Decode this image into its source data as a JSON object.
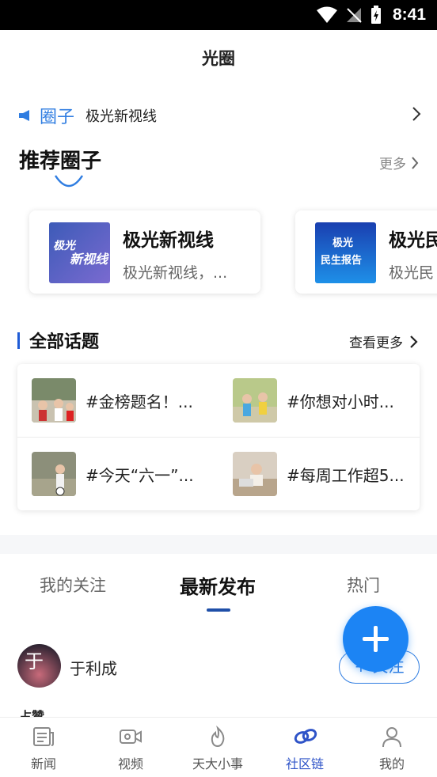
{
  "status_bar": {
    "time": "8:41"
  },
  "header": {
    "title": "光圈"
  },
  "circle_bar": {
    "tag": "圈子",
    "name": "极光新视线"
  },
  "recommend": {
    "title": "推荐圈子",
    "more_label": "更多",
    "cards": [
      {
        "title": "极光新视线",
        "desc": "极光新视线，...",
        "logo_text_1": "极光",
        "logo_text_2": "新视线"
      },
      {
        "title": "极光民",
        "desc": "极光民",
        "logo_text_1": "极光",
        "logo_text_2": "民生报告"
      }
    ]
  },
  "topics": {
    "title": "全部话题",
    "more_label": "查看更多",
    "items": [
      {
        "text": "#金榜题名！..."
      },
      {
        "text": "#你想对小时..."
      },
      {
        "text": "#今天“六一”..."
      },
      {
        "text": "#每周工作超5..."
      }
    ]
  },
  "feed_tabs": [
    {
      "label": "我的关注",
      "active": false
    },
    {
      "label": "最新发布",
      "active": true
    },
    {
      "label": "热门",
      "active": false
    }
  ],
  "post": {
    "user_name": "于利成",
    "avatar_char": "于",
    "follow_label": "+ 关注",
    "snippet": "占赞"
  },
  "bottom_nav": [
    {
      "label": "新闻",
      "icon": "newspaper-icon",
      "active": false
    },
    {
      "label": "视频",
      "icon": "video-camera-icon",
      "active": false
    },
    {
      "label": "天大小事",
      "icon": "flame-icon",
      "active": false
    },
    {
      "label": "社区链",
      "icon": "chain-link-icon",
      "active": true
    },
    {
      "label": "我的",
      "icon": "person-icon",
      "active": false
    }
  ],
  "colors": {
    "accent": "#2f7de1",
    "fab": "#1c84f4",
    "nav_active": "#2f54c8",
    "topic_bar": "#1f5bd6"
  }
}
